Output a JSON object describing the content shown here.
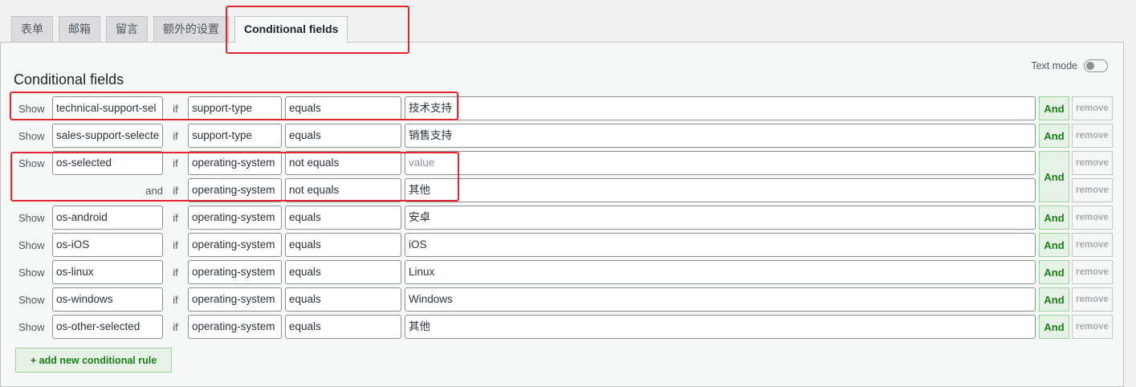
{
  "tabs": [
    {
      "label": "表单"
    },
    {
      "label": "邮箱"
    },
    {
      "label": "留言"
    },
    {
      "label": "额外的设置"
    },
    {
      "label": "Conditional fields"
    }
  ],
  "active_tab": 4,
  "panel": {
    "title": "Conditional fields",
    "text_mode_label": "Text mode"
  },
  "labels": {
    "show": "Show",
    "if": "if",
    "and": "and",
    "and_button": "And",
    "remove_button": "remove"
  },
  "rules": [
    {
      "target": "technical-support-sel",
      "conditions": [
        {
          "field": "support-type",
          "operator": "equals",
          "value": "技术支持"
        }
      ]
    },
    {
      "target": "sales-support-selecte",
      "conditions": [
        {
          "field": "support-type",
          "operator": "equals",
          "value": "销售支持"
        }
      ]
    },
    {
      "target": "os-selected",
      "conditions": [
        {
          "field": "operating-system",
          "operator": "not equals",
          "value": "",
          "placeholder": "value"
        },
        {
          "field": "operating-system",
          "operator": "not equals",
          "value": "其他"
        }
      ]
    },
    {
      "target": "os-android",
      "conditions": [
        {
          "field": "operating-system",
          "operator": "equals",
          "value": "安卓"
        }
      ]
    },
    {
      "target": "os-iOS",
      "conditions": [
        {
          "field": "operating-system",
          "operator": "equals",
          "value": "iOS"
        }
      ]
    },
    {
      "target": "os-linux",
      "conditions": [
        {
          "field": "operating-system",
          "operator": "equals",
          "value": "Linux"
        }
      ]
    },
    {
      "target": "os-windows",
      "conditions": [
        {
          "field": "operating-system",
          "operator": "equals",
          "value": "Windows"
        }
      ]
    },
    {
      "target": "os-other-selected",
      "conditions": [
        {
          "field": "operating-system",
          "operator": "equals",
          "value": "其他"
        }
      ]
    }
  ],
  "add_rule_label": "+ add new conditional rule",
  "colors": {
    "annotation": "#e3262b",
    "accent_green": "#1a7d1a"
  }
}
